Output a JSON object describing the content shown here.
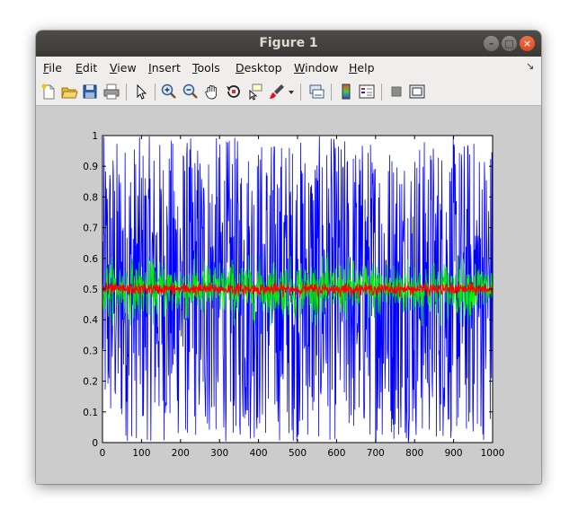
{
  "window": {
    "title": "Figure 1"
  },
  "menu": {
    "items": [
      "File",
      "Edit",
      "View",
      "Insert",
      "Tools",
      "Desktop",
      "Window",
      "Help"
    ]
  },
  "toolbar": {
    "icons": [
      "new-figure-icon",
      "open-file-icon",
      "save-icon",
      "print-icon",
      "edit-plot-arrow-icon",
      "zoom-in-icon",
      "zoom-out-icon",
      "pan-hand-icon",
      "rotate-3d-icon",
      "data-cursor-icon",
      "brush-icon",
      "brush-dropdown-icon",
      "link-plot-icon",
      "insert-colorbar-icon",
      "insert-legend-icon",
      "hide-plot-tools-icon",
      "show-plot-tools-icon"
    ]
  },
  "colors": {
    "blue_series": "#0000ff",
    "green_series": "#00ee00",
    "red_series": "#ff0000",
    "figure_background": "#cccccc"
  },
  "chart_data": {
    "type": "line",
    "title": "",
    "xlabel": "",
    "ylabel": "",
    "xlim": [
      0,
      1000
    ],
    "ylim": [
      0,
      1
    ],
    "xticks": [
      0,
      100,
      200,
      300,
      400,
      500,
      600,
      700,
      800,
      900,
      1000
    ],
    "yticks": [
      0,
      0.1,
      0.2,
      0.3,
      0.4,
      0.5,
      0.6,
      0.7,
      0.8,
      0.9,
      1
    ],
    "grid": false,
    "legend": "none",
    "series": [
      {
        "color": "#0000ff",
        "description_of_values": "uniform random noise",
        "x_range": [
          1,
          1000
        ],
        "mean": 0.5,
        "min": 0,
        "max": 1
      },
      {
        "color": "#00ee00",
        "description_of_values": "noise",
        "x_range": [
          1,
          1000
        ],
        "mean": 0.5,
        "min": 0.38,
        "max": 0.62
      },
      {
        "color": "#ff0000",
        "description_of_values": "noise",
        "x_range": [
          1,
          1000
        ],
        "mean": 0.5,
        "min": 0.47,
        "max": 0.53
      }
    ]
  }
}
